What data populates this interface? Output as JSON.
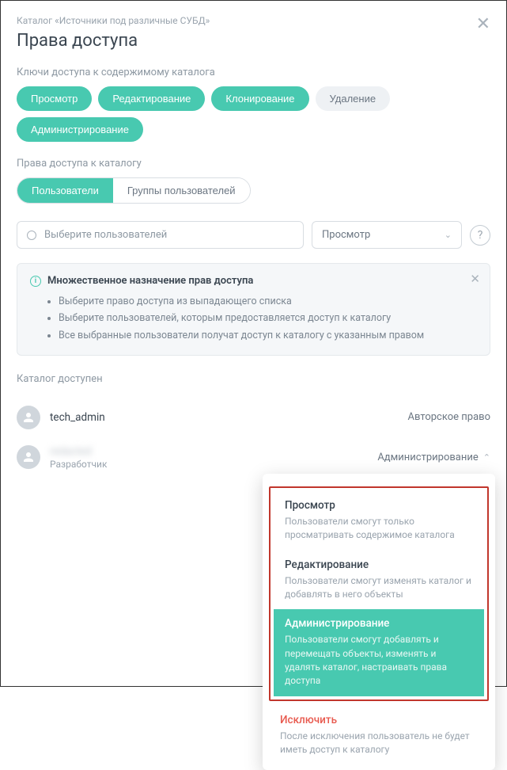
{
  "breadcrumb": "Каталог «Источники под различные СУБД»",
  "page_title": "Права доступа",
  "sections": {
    "keys_label": "Ключи доступа к содержимому каталога",
    "rights_label": "Права доступа к каталогу",
    "available_label": "Каталог доступен"
  },
  "key_pills": [
    {
      "label": "Просмотр",
      "active": true
    },
    {
      "label": "Редактирование",
      "active": true
    },
    {
      "label": "Клонирование",
      "active": true
    },
    {
      "label": "Удаление",
      "active": false
    },
    {
      "label": "Администрирование",
      "active": true
    }
  ],
  "tabs": [
    {
      "label": "Пользователи",
      "active": true
    },
    {
      "label": "Группы пользователей",
      "active": false
    }
  ],
  "user_select_placeholder": "Выберите пользователей",
  "perm_select_value": "Просмотр",
  "info": {
    "title": "Множественное назначение прав доступа",
    "bullets": [
      "Выберите право доступа из выпадающего списка",
      "Выберите пользователей, которым предоставляется доступ к каталогу",
      "Все выбранные пользователи получат доступ к каталогу с указанным правом"
    ]
  },
  "users": [
    {
      "name": "tech_admin",
      "sub": "",
      "perm_label": "Авторское право",
      "blur": false
    },
    {
      "name": "redacted",
      "sub": "Разработчик",
      "perm_label": "Администрирование",
      "blur": true
    }
  ],
  "dropdown": {
    "items": [
      {
        "title": "Просмотр",
        "desc": "Пользователи смогут только просматривать содержимое каталога",
        "selected": false
      },
      {
        "title": "Редактирование",
        "desc": "Пользователи смогут изменять каталог и добавлять в него объекты",
        "selected": false
      },
      {
        "title": "Администрирование",
        "desc": "Пользователи смогут добавлять и перемещать объекты, изменять и удалять каталог, настраивать права доступа",
        "selected": true
      }
    ],
    "exclude": {
      "title": "Исключить",
      "desc": "После исключения пользователь не будет иметь доступ к каталогу"
    }
  }
}
